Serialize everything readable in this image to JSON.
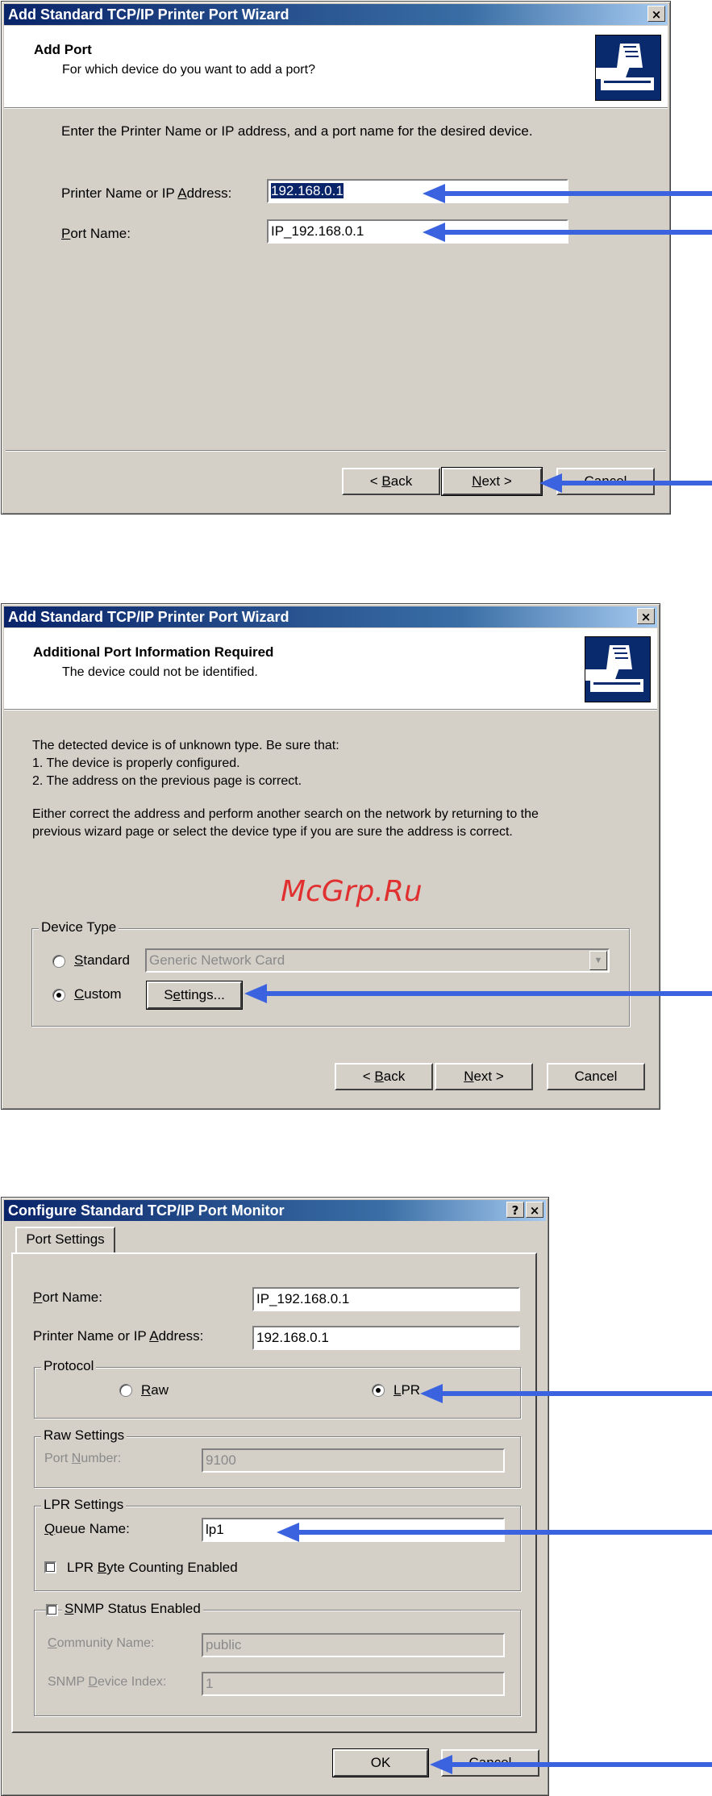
{
  "dialog1": {
    "title": "Add Standard TCP/IP Printer Port Wizard",
    "close": "×",
    "header_title": "Add Port",
    "header_subtitle": "For which device do you want to add a port?",
    "instruction": "Enter the Printer Name or IP address, and a port name for the desired device.",
    "printer_label_pre": "Printer Name or IP ",
    "printer_label_key": "A",
    "printer_label_post": "ddress:",
    "printer_value": "192.168.0.1",
    "port_label_key": "P",
    "port_label_post": "ort Name:",
    "port_value": "IP_192.168.0.1",
    "back_pre": "< ",
    "back_key": "B",
    "back_post": "ack",
    "next_key": "N",
    "next_post": "ext >",
    "cancel": "Cancel"
  },
  "dialog2": {
    "title": "Add Standard TCP/IP Printer Port Wizard",
    "close": "×",
    "header_title": "Additional Port Information Required",
    "header_subtitle": "The device could not be identified.",
    "body_line1": "The detected device is of unknown type.  Be sure that:",
    "body_line2": "1. The device is properly configured.",
    "body_line3": "2.  The address on the previous page is correct.",
    "body_line4": "Either correct the address and perform another search on the network by returning to the",
    "body_line5": "previous wizard page or select the device type if you are sure the address is correct.",
    "watermark": "McGrp.Ru",
    "group_title": "Device Type",
    "standard_key": "S",
    "standard_post": "tandard",
    "standard_value": "Generic Network Card",
    "custom_key": "C",
    "custom_post": "ustom",
    "settings_pre": "S",
    "settings_key": "e",
    "settings_post": "ttings...",
    "back_pre": "< ",
    "back_key": "B",
    "back_post": "ack",
    "next_key": "N",
    "next_post": "ext >",
    "cancel": "Cancel"
  },
  "dialog3": {
    "title": "Configure Standard TCP/IP Port Monitor",
    "help": "?",
    "close": "×",
    "tab": "Port Settings",
    "port_label_key": "P",
    "port_label_post": "ort Name:",
    "port_value": "IP_192.168.0.1",
    "printer_label_pre": "Printer Name or IP ",
    "printer_label_key": "A",
    "printer_label_post": "ddress:",
    "printer_value": "192.168.0.1",
    "protocol_title": "Protocol",
    "raw_key": "R",
    "raw_post": "aw",
    "lpr_key": "L",
    "lpr_post": "PR",
    "raw_settings_title": "Raw Settings",
    "port_number_pre": "Port ",
    "port_number_key": "N",
    "port_number_post": "umber:",
    "port_number_value": "9100",
    "lpr_settings_title": "LPR Settings",
    "queue_key": "Q",
    "queue_post": "ueue Name:",
    "queue_value": "lp1",
    "byte_pre": "LPR ",
    "byte_key": "B",
    "byte_post": "yte Counting Enabled",
    "snmp_key": "S",
    "snmp_post": "NMP Status Enabled",
    "community_pre": "",
    "community_key": "C",
    "community_post": "ommunity Name:",
    "community_value": "public",
    "device_index_pre": "SNMP ",
    "device_index_key": "D",
    "device_index_post": "evice Index:",
    "device_index_value": "1",
    "ok": "OK",
    "cancel": "Cancel"
  },
  "colors": {
    "arrow": "#3b63e0",
    "titlebar": "#0a246a",
    "dialog_face": "#d4d0c8"
  }
}
